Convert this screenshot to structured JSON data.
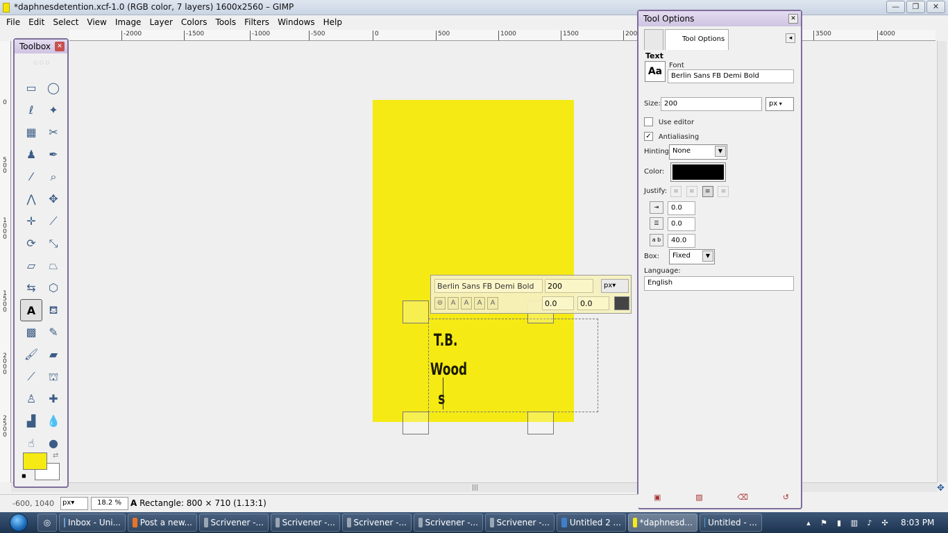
{
  "window": {
    "title": "*daphnesdetention.xcf-1.0 (RGB color, 7 layers) 1600x2560 – GIMP",
    "controls": {
      "minimize": "—",
      "maximize": "❐",
      "close": "✕"
    }
  },
  "menu": [
    "File",
    "Edit",
    "Select",
    "View",
    "Image",
    "Layer",
    "Colors",
    "Tools",
    "Filters",
    "Windows",
    "Help"
  ],
  "ruler": {
    "h_labels": [
      "-2000",
      "-1500",
      "-1000",
      "-500",
      "0",
      "500",
      "1000",
      "1500",
      "2000"
    ],
    "h_labels_right": [
      "3500",
      "4000"
    ],
    "v_labels": [
      "0",
      "5\n0\n0",
      "1\n0\n0\n0",
      "1\n5\n0\n0",
      "2\n0\n0\n0",
      "2\n5\n0\n0"
    ]
  },
  "toolbox": {
    "title": "Toolbox",
    "close": "✕",
    "tools": [
      {
        "name": "rect-select-icon",
        "glyph": "▭"
      },
      {
        "name": "ellipse-select-icon",
        "glyph": "◯"
      },
      {
        "name": "free-select-icon",
        "glyph": "ℓ"
      },
      {
        "name": "fuzzy-select-icon",
        "glyph": "✦"
      },
      {
        "name": "color-select-icon",
        "glyph": "▦"
      },
      {
        "name": "scissors-icon",
        "glyph": "✂"
      },
      {
        "name": "foreground-select-icon",
        "glyph": "♟"
      },
      {
        "name": "paths-icon",
        "glyph": "✒"
      },
      {
        "name": "color-picker-icon",
        "glyph": "⁄"
      },
      {
        "name": "zoom-icon",
        "glyph": "⌕"
      },
      {
        "name": "measure-icon",
        "glyph": "⋀"
      },
      {
        "name": "move-icon",
        "glyph": "✥"
      },
      {
        "name": "align-icon",
        "glyph": "✛"
      },
      {
        "name": "crop-icon",
        "glyph": "⟋"
      },
      {
        "name": "rotate-icon",
        "glyph": "⟳"
      },
      {
        "name": "scale-icon",
        "glyph": "⤡"
      },
      {
        "name": "shear-icon",
        "glyph": "▱"
      },
      {
        "name": "perspective-icon",
        "glyph": "⏢"
      },
      {
        "name": "flip-icon",
        "glyph": "⇆"
      },
      {
        "name": "cage-icon",
        "glyph": "⬡"
      },
      {
        "name": "text-tool-icon",
        "glyph": "A"
      },
      {
        "name": "bucket-fill-icon",
        "glyph": "⛾"
      },
      {
        "name": "blend-icon",
        "glyph": "▩"
      },
      {
        "name": "pencil-icon",
        "glyph": "✎"
      },
      {
        "name": "paintbrush-icon",
        "glyph": "🖌"
      },
      {
        "name": "eraser-icon",
        "glyph": "▰"
      },
      {
        "name": "airbrush-icon",
        "glyph": "⟋"
      },
      {
        "name": "ink-icon",
        "glyph": "⛫"
      },
      {
        "name": "clone-icon",
        "glyph": "♙"
      },
      {
        "name": "heal-icon",
        "glyph": "✚"
      },
      {
        "name": "perspective-clone-icon",
        "glyph": "▟"
      },
      {
        "name": "blur-icon",
        "glyph": "💧"
      },
      {
        "name": "smudge-icon",
        "glyph": "☝"
      },
      {
        "name": "dodge-burn-icon",
        "glyph": "●"
      }
    ],
    "fg_color": "#f5ea14",
    "bg_color": "#ffffff"
  },
  "canvas": {
    "image_color": "#f5ea14",
    "text_lines": [
      "T.B.",
      "Wood",
      "s"
    ],
    "text_toolbar": {
      "font": "Berlin Sans FB Demi Bold",
      "size": "200",
      "unit": "px▾",
      "baseline": "0.0",
      "kerning": "0.0"
    }
  },
  "tool_options": {
    "window_title": "Tool Options",
    "tab_label": "Tool Options",
    "section": "Text",
    "font_label": "Font",
    "font_value": "Berlin Sans FB Demi Bold",
    "font_preview": "Aa",
    "size_label": "Size:",
    "size_value": "200",
    "size_unit": "px",
    "use_editor_label": "Use editor",
    "use_editor_checked": false,
    "antialiasing_label": "Antialiasing",
    "antialiasing_checked": true,
    "hinting_label": "Hinting:",
    "hinting_value": "None",
    "color_label": "Color:",
    "color_value": "#000000",
    "justify_label": "Justify:",
    "indent_value": "0.0",
    "line_spacing_value": "0.0",
    "letter_spacing_value": "40.0",
    "box_label": "Box:",
    "box_value": "Fixed",
    "language_label": "Language:",
    "language_value": "English"
  },
  "status": {
    "coords": "-600, 1040",
    "unit": "px▾",
    "zoom": "18.2 %",
    "message": "Rectangle: 800 × 710  (1.13:1)"
  },
  "taskbar": {
    "tasks": [
      {
        "label": "Inbox - Uni...",
        "icon_color": "#6aa0d8"
      },
      {
        "label": "Post a new...",
        "icon_color": "#e8742a"
      },
      {
        "label": "Scrivener -...",
        "icon_color": "#9aa6b4"
      },
      {
        "label": "Scrivener -...",
        "icon_color": "#9aa6b4"
      },
      {
        "label": "Scrivener -...",
        "icon_color": "#9aa6b4"
      },
      {
        "label": "Scrivener -...",
        "icon_color": "#9aa6b4"
      },
      {
        "label": "Scrivener -...",
        "icon_color": "#9aa6b4"
      },
      {
        "label": "Untitled 2 ...",
        "icon_color": "#3f7fc9"
      },
      {
        "label": "*daphnesd...",
        "icon_color": "#f5ea14"
      },
      {
        "label": "Untitled - ...",
        "icon_color": "#4ea0d8"
      }
    ],
    "clock": "8:03 PM"
  }
}
